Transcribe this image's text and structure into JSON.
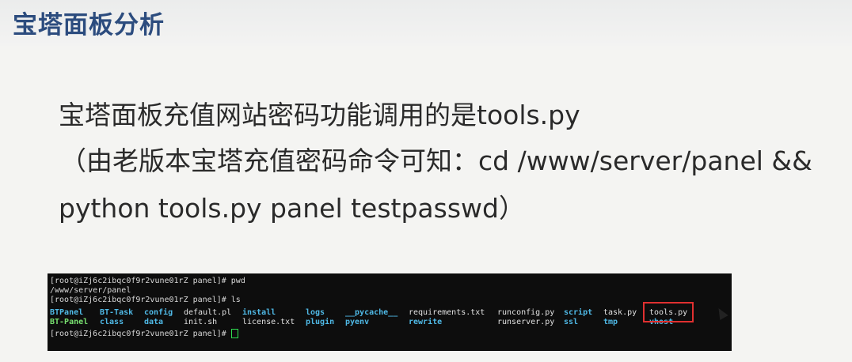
{
  "slide": {
    "title": "宝塔面板分析",
    "lines": [
      "宝塔面板充值网站密码功能调用的是tools.py",
      "（由老版本宝塔充值密码命令可知：cd /www/server/panel &&",
      "python tools.py panel testpasswd）"
    ]
  },
  "terminal": {
    "prompt_pwd": "[root@iZj6c2ibqc0f9r2vune01rZ panel]# pwd",
    "pwd_output": "/www/server/panel",
    "prompt_ls": "[root@iZj6c2ibqc0f9r2vune01rZ panel]# ls",
    "ls_row1": [
      "BTPanel",
      "BT-Task",
      "config",
      "default.pl",
      "install",
      "logs",
      "__pycache__",
      "requirements.txt",
      "runconfig.py",
      "script",
      "task.py",
      "tools.py"
    ],
    "ls_row2": [
      "BT-Panel",
      "class",
      "data",
      "init.sh",
      "license.txt",
      "plugin",
      "pyenv",
      "rewrite",
      "runserver.py",
      "ssl",
      "tmp",
      "vhost"
    ],
    "prompt_last": "[root@iZj6c2ibqc0f9r2vune01rZ panel]#",
    "highlighted_file": "tools.py",
    "highlight_color": "#e03030"
  }
}
